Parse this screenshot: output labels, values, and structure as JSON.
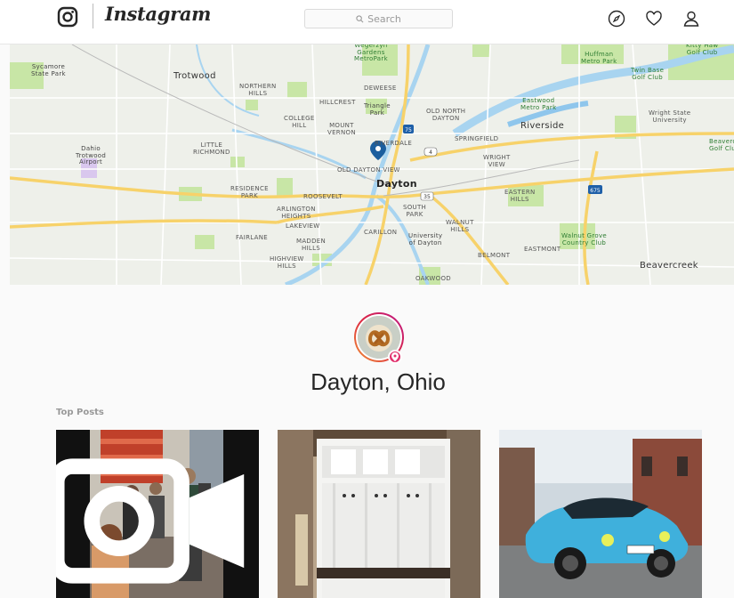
{
  "header": {
    "brand": "Instagram",
    "search_placeholder": "Search",
    "icons": [
      "instagram-logo-icon",
      "compass-icon",
      "heart-icon",
      "profile-icon"
    ]
  },
  "map": {
    "labels": {
      "sycamore": "Sycamore\nState Park",
      "trotwood": "Trotwood",
      "northern_hills": "NORTHERN\nHILLS",
      "hillcrest": "HILLCREST",
      "dewitt": "DEWEESE",
      "college_hill": "COLLEGE\nHILL",
      "mount_vernon": "MOUNT\nVERNON",
      "triangle_park": "Triangle\nPark",
      "old_north_dayton": "OLD NORTH\nDAYTON",
      "riverdale": "RIVERDALE",
      "old_dayton_view": "OLD DAYTON VIEW",
      "dayton": "Dayton",
      "little_richmond": "LITTLE\nRICHMOND",
      "springfield": "SPRINGFIELD",
      "wright_view": "WRIGHT\nVIEW",
      "residence_park": "RESIDENCE\nPARK",
      "roosevelt": "ROOSEVELT",
      "arlington_heights": "ARLINGTON\nHEIGHTS",
      "lakeview": "LAKEVIEW",
      "south_park": "SOUTH\nPARK",
      "eastern_hills": "EASTERN\nHILLS",
      "fairlane": "FAIRLANE",
      "carillon": "CARILLON",
      "university": "University\nof Dayton",
      "walnut_hills": "WALNUT\nHILLS",
      "madden_hills": "MADDEN\nHILLS",
      "highview_hills": "HIGHVIEW\nHILLS",
      "oakwood": "OAKWOOD",
      "belmont": "BELMONT",
      "eastmont": "EASTMONT",
      "walnut_grove": "Walnut Grove\nCountry Club",
      "beavercreek": "Beavercreek",
      "riverside": "Riverside",
      "eastwood": "Eastwood\nMetro Park",
      "wright_state": "Wright State\nUniversity",
      "twin_base": "Twin Base\nGolf Club",
      "huffman": "Huffman\nMetro Park",
      "wegerzyn": "Wegerzyn\nGardens\nMetroPark",
      "airport": "Dahio\nTrotwood\nAirport",
      "beavercreek_golf": "Beavercre\nGolf Clu",
      "kitty_hawk": "Kitty Haw\nGolf Club"
    },
    "shields": [
      "75",
      "4",
      "35",
      "675"
    ]
  },
  "location": {
    "name": "Dayton, Ohio",
    "section": "Top Posts"
  },
  "colors": {
    "accent": "#e1306c",
    "pin": "#1b5e9e",
    "water": "#a8d4f0",
    "highway": "#f7d26a",
    "park": "#c8e6a6"
  },
  "posts": [
    {
      "kind": "video"
    },
    {
      "kind": "photo"
    },
    {
      "kind": "photo"
    }
  ]
}
